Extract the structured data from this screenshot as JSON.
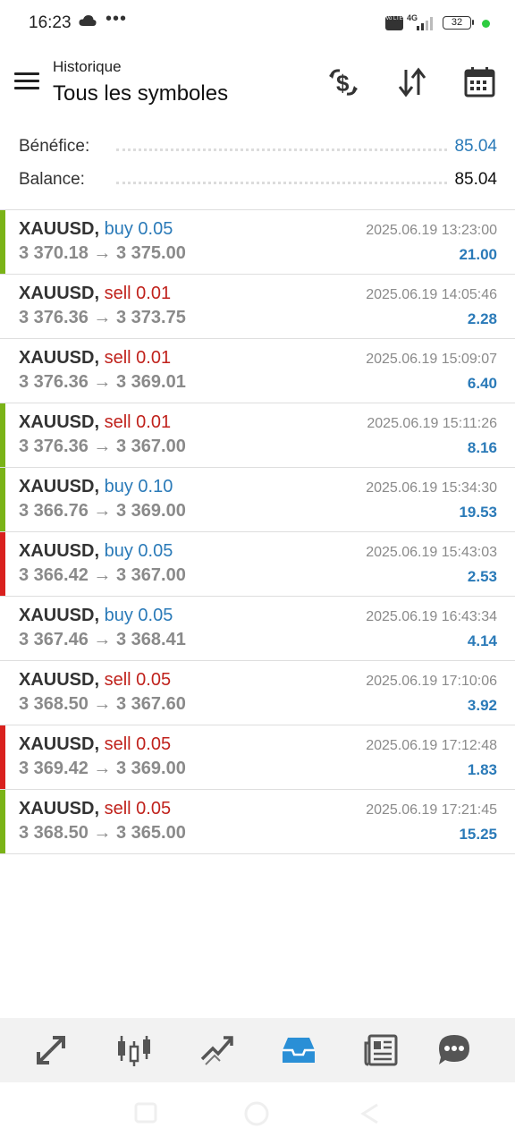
{
  "status_bar": {
    "time": "16:23",
    "dots": "•••",
    "volte": "Vo LTE",
    "network": "4G",
    "battery": "32"
  },
  "header": {
    "subtitle": "Historique",
    "title": "Tous les symboles"
  },
  "summary": {
    "profit_label": "Bénéfice:",
    "profit_value": "85.04",
    "balance_label": "Balance:",
    "balance_value": "85.04"
  },
  "arrow": "→",
  "trades": [
    {
      "symbol": "XAUUSD,",
      "direction": "buy",
      "volume": "0.05",
      "open": "3 370.18",
      "close": "3 375.00",
      "time": "2025.06.19 13:23:00",
      "profit": "21.00",
      "marker": "green"
    },
    {
      "symbol": "XAUUSD,",
      "direction": "sell",
      "volume": "0.01",
      "open": "3 376.36",
      "close": "3 373.75",
      "time": "2025.06.19 14:05:46",
      "profit": "2.28",
      "marker": "none"
    },
    {
      "symbol": "XAUUSD,",
      "direction": "sell",
      "volume": "0.01",
      "open": "3 376.36",
      "close": "3 369.01",
      "time": "2025.06.19 15:09:07",
      "profit": "6.40",
      "marker": "none"
    },
    {
      "symbol": "XAUUSD,",
      "direction": "sell",
      "volume": "0.01",
      "open": "3 376.36",
      "close": "3 367.00",
      "time": "2025.06.19 15:11:26",
      "profit": "8.16",
      "marker": "green"
    },
    {
      "symbol": "XAUUSD,",
      "direction": "buy",
      "volume": "0.10",
      "open": "3 366.76",
      "close": "3 369.00",
      "time": "2025.06.19 15:34:30",
      "profit": "19.53",
      "marker": "green"
    },
    {
      "symbol": "XAUUSD,",
      "direction": "buy",
      "volume": "0.05",
      "open": "3 366.42",
      "close": "3 367.00",
      "time": "2025.06.19 15:43:03",
      "profit": "2.53",
      "marker": "red"
    },
    {
      "symbol": "XAUUSD,",
      "direction": "buy",
      "volume": "0.05",
      "open": "3 367.46",
      "close": "3 368.41",
      "time": "2025.06.19 16:43:34",
      "profit": "4.14",
      "marker": "none"
    },
    {
      "symbol": "XAUUSD,",
      "direction": "sell",
      "volume": "0.05",
      "open": "3 368.50",
      "close": "3 367.60",
      "time": "2025.06.19 17:10:06",
      "profit": "3.92",
      "marker": "none"
    },
    {
      "symbol": "XAUUSD,",
      "direction": "sell",
      "volume": "0.05",
      "open": "3 369.42",
      "close": "3 369.00",
      "time": "2025.06.19 17:12:48",
      "profit": "1.83",
      "marker": "red"
    },
    {
      "symbol": "XAUUSD,",
      "direction": "sell",
      "volume": "0.05",
      "open": "3 368.50",
      "close": "3 365.00",
      "time": "2025.06.19 17:21:45",
      "profit": "15.25",
      "marker": "green"
    }
  ],
  "colors": {
    "accent": "#2a7ab8",
    "buy": "#2a7ab8",
    "sell": "#c0221c",
    "marker_green": "#7ab317",
    "marker_red": "#d9211e",
    "nav_bg": "#f2f2f2"
  },
  "header_icons": [
    "currency-exchange-icon",
    "sort-icon",
    "calendar-icon"
  ],
  "bottom_nav": [
    {
      "icon": "quotes-icon",
      "active": false
    },
    {
      "icon": "chart-icon",
      "active": false
    },
    {
      "icon": "trade-icon",
      "active": false
    },
    {
      "icon": "history-icon",
      "active": true
    },
    {
      "icon": "news-icon",
      "active": false
    },
    {
      "icon": "messages-icon",
      "active": false
    }
  ]
}
